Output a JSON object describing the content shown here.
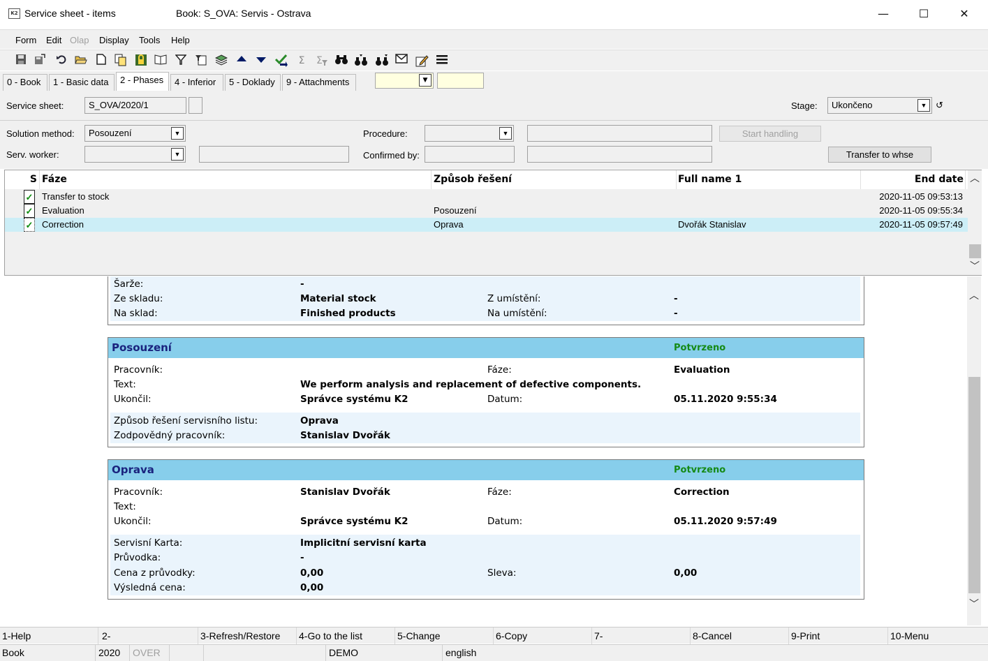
{
  "window": {
    "title": "Service sheet - items",
    "book_title": "Book: S_OVA: Servis - Ostrava",
    "minimize": "—",
    "maximize": "☐",
    "close": "✕"
  },
  "menu": {
    "form": "Form",
    "edit": "Edit",
    "olap": "Olap",
    "display": "Display",
    "tools": "Tools",
    "help": "Help"
  },
  "toolbar_icons": [
    "save-icon",
    "save-all-icon",
    "undo-icon",
    "open-folder-icon",
    "new-document-icon",
    "copy-icon",
    "lock-icon",
    "book-icon",
    "filter-icon",
    "filter-doc-icon",
    "layers-icon",
    "arrow-up-icon",
    "arrow-down-icon",
    "check-arrow-icon",
    "sum-icon",
    "sum-filter-icon",
    "binoculars-icon",
    "binoculars-next-icon",
    "binoculars-prev-icon",
    "mail-icon",
    "edit-icon",
    "menu-icon"
  ],
  "tabs": [
    {
      "label": "0 - Book",
      "active": false
    },
    {
      "label": "1 - Basic data",
      "active": false
    },
    {
      "label": "2 - Phases",
      "active": true
    },
    {
      "label": "4 - Inferior",
      "active": false
    },
    {
      "label": "5 - Doklady",
      "active": false
    },
    {
      "label": "9 - Attachments",
      "active": false
    }
  ],
  "form": {
    "service_sheet_label": "Service sheet:",
    "service_sheet_value": "S_OVA/2020/1",
    "stage_label": "Stage:",
    "stage_value": "Ukončeno",
    "solution_method_label": "Solution method:",
    "solution_method_value": "Posouzení",
    "procedure_label": "Procedure:",
    "procedure_value": "",
    "start_handling": "Start handling",
    "serv_worker_label": "Serv. worker:",
    "serv_worker_value": "",
    "confirmed_by_label": "Confirmed by:",
    "transfer_to_whse": "Transfer to whse"
  },
  "grid": {
    "columns": {
      "s": "S",
      "faze": "Fáze",
      "zpusob": "Způsob řešení",
      "fullname": "Full name 1",
      "enddate": "End date"
    },
    "rows": [
      {
        "faze": "Transfer to stock",
        "zpusob": "",
        "fullname": "",
        "enddate": "2020-11-05 09:53:13",
        "selected": false
      },
      {
        "faze": "Evaluation",
        "zpusob": "Posouzení",
        "fullname": "",
        "enddate": "2020-11-05 09:55:34",
        "selected": false
      },
      {
        "faze": "Correction",
        "zpusob": "Oprava",
        "fullname": "Dvořák Stanislav",
        "enddate": "2020-11-05 09:57:49",
        "selected": true
      }
    ]
  },
  "report": {
    "top": {
      "sarze_k": "Šarže:",
      "sarze_v": "-",
      "ze_skladu_k": "Ze skladu:",
      "ze_skladu_v": "Material stock",
      "z_umisteni_k": "Z umístění:",
      "z_umisteni_v": "-",
      "na_sklad_k": "Na sklad:",
      "na_sklad_v": "Finished products",
      "na_umisteni_k": "Na umístění:",
      "na_umisteni_v": "-"
    },
    "posouzeni": {
      "title": "Posouzení",
      "status": "Potvrzeno",
      "pracovnik_k": "Pracovník:",
      "pracovnik_v": "",
      "faze_k": "Fáze:",
      "faze_v": "Evaluation",
      "text_k": "Text:",
      "text_v": "We perform analysis and replacement of defective components.",
      "ukoncil_k": "Ukončil:",
      "ukoncil_v": "Správce systému K2",
      "datum_k": "Datum:",
      "datum_v": "05.11.2020 9:55:34",
      "zpusob_k": "Způsob řešení servisního listu:",
      "zpusob_v": "Oprava",
      "zodp_k": "Zodpovědný pracovník:",
      "zodp_v": "Stanislav Dvořák"
    },
    "oprava": {
      "title": "Oprava",
      "status": "Potvrzeno",
      "pracovnik_k": "Pracovník:",
      "pracovnik_v": "Stanislav Dvořák",
      "faze_k": "Fáze:",
      "faze_v": "Correction",
      "text_k": "Text:",
      "text_v": "",
      "ukoncil_k": "Ukončil:",
      "ukoncil_v": "Správce systému K2",
      "datum_k": "Datum:",
      "datum_v": "05.11.2020 9:57:49",
      "karta_k": "Servisní Karta:",
      "karta_v": "Implicitní servisní karta",
      "pruvodka_k": "Průvodka:",
      "pruvodka_v": "-",
      "cena_k": "Cena z průvodky:",
      "cena_v": "0,00",
      "sleva_k": "Sleva:",
      "sleva_v": "0,00",
      "vysledna_k": "Výsledná cena:",
      "vysledna_v": "0,00"
    }
  },
  "fkeys": [
    "1-Help",
    "2-",
    "3-Refresh/Restore",
    "4-Go to the list",
    "5-Change",
    "6-Copy",
    "7-",
    "8-Cancel",
    "9-Print",
    "10-Menu"
  ],
  "status": {
    "book": "Book",
    "year": "2020",
    "over": "OVER",
    "demo": "DEMO",
    "language": "english"
  },
  "colors": {
    "panel_header": "#87ceeb",
    "status_green": "#158a15",
    "selected_row": "#cceef7",
    "input_yellow": "#ffffe0"
  }
}
